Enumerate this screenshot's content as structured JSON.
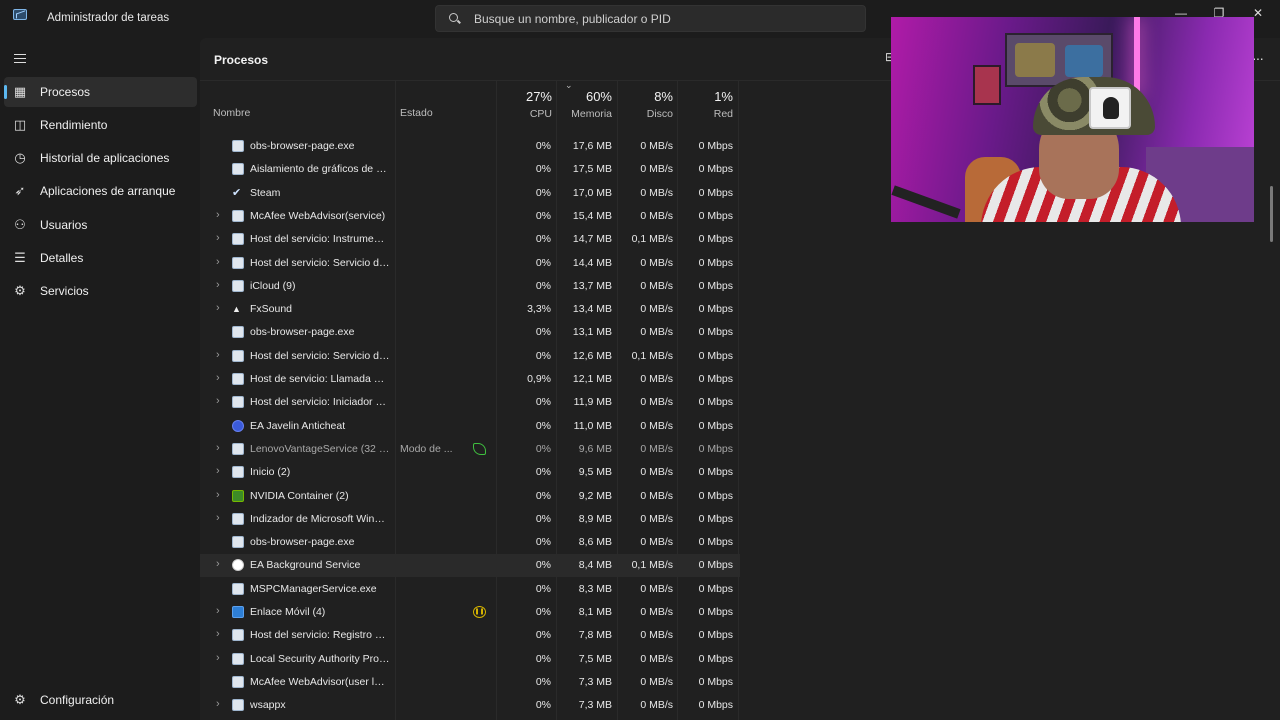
{
  "app": {
    "title": "Administrador de tareas",
    "search_placeholder": "Busque un nombre, publicador o PID",
    "window_buttons": {
      "minimize": "—",
      "restore": "❐",
      "close": "✕"
    }
  },
  "sidebar": {
    "items": [
      {
        "label": "Procesos",
        "icon": "processes-icon",
        "active": true
      },
      {
        "label": "Rendimiento",
        "icon": "performance-icon"
      },
      {
        "label": "Historial de aplicaciones",
        "icon": "history-icon"
      },
      {
        "label": "Aplicaciones de arranque",
        "icon": "startup-icon"
      },
      {
        "label": "Usuarios",
        "icon": "users-icon"
      },
      {
        "label": "Detalles",
        "icon": "details-icon"
      },
      {
        "label": "Servicios",
        "icon": "services-icon"
      }
    ],
    "settings_label": "Configuración"
  },
  "main": {
    "title": "Procesos",
    "columns": {
      "name": "Nombre",
      "status": "Estado",
      "cpu": {
        "pct": "27%",
        "label": "CPU"
      },
      "memory": {
        "pct": "60%",
        "label": "Memoria"
      },
      "disk": {
        "pct": "8%",
        "label": "Disco"
      },
      "network": {
        "pct": "1%",
        "label": "Red"
      }
    },
    "rows": [
      {
        "name": "obs-browser-page.exe",
        "expand": false,
        "icon": "window",
        "status": "",
        "cpu": "0%",
        "mem": "17,6 MB",
        "disk": "0 MB/s",
        "net": "0 Mbps"
      },
      {
        "name": "Aislamiento de gráficos de dis...",
        "expand": false,
        "icon": "window",
        "status": "",
        "cpu": "0%",
        "mem": "17,5 MB",
        "disk": "0 MB/s",
        "net": "0 Mbps"
      },
      {
        "name": "Steam",
        "expand": false,
        "icon": "steam",
        "status": "",
        "cpu": "0%",
        "mem": "17,0 MB",
        "disk": "0 MB/s",
        "net": "0 Mbps"
      },
      {
        "name": "McAfee WebAdvisor(service)",
        "expand": true,
        "icon": "window",
        "status": "",
        "cpu": "0%",
        "mem": "15,4 MB",
        "disk": "0 MB/s",
        "net": "0 Mbps"
      },
      {
        "name": "Host del servicio: Instrumental...",
        "expand": true,
        "icon": "gear",
        "status": "",
        "cpu": "0%",
        "mem": "14,7 MB",
        "disk": "0,1 MB/s",
        "net": "0 Mbps"
      },
      {
        "name": "Host del servicio: Servicio de r...",
        "expand": true,
        "icon": "gear",
        "status": "",
        "cpu": "0%",
        "mem": "14,4 MB",
        "disk": "0 MB/s",
        "net": "0 Mbps"
      },
      {
        "name": "iCloud (9)",
        "expand": true,
        "icon": "window",
        "status": "",
        "cpu": "0%",
        "mem": "13,7 MB",
        "disk": "0 MB/s",
        "net": "0 Mbps"
      },
      {
        "name": "FxSound",
        "expand": true,
        "icon": "fx",
        "status": "",
        "cpu": "3,3%",
        "mem": "13,4 MB",
        "disk": "0 MB/s",
        "net": "0 Mbps"
      },
      {
        "name": "obs-browser-page.exe",
        "expand": false,
        "icon": "window",
        "status": "",
        "cpu": "0%",
        "mem": "13,1 MB",
        "disk": "0 MB/s",
        "net": "0 Mbps"
      },
      {
        "name": "Host del servicio: Servicio de ...",
        "expand": true,
        "icon": "gear",
        "status": "",
        "cpu": "0%",
        "mem": "12,6 MB",
        "disk": "0,1 MB/s",
        "net": "0 Mbps"
      },
      {
        "name": "Host de servicio: Llamada a pr...",
        "expand": true,
        "icon": "gear",
        "status": "",
        "cpu": "0,9%",
        "mem": "12,1 MB",
        "disk": "0 MB/s",
        "net": "0 Mbps"
      },
      {
        "name": "Host del servicio: Iniciador de ...",
        "expand": true,
        "icon": "gear",
        "status": "",
        "cpu": "0%",
        "mem": "11,9 MB",
        "disk": "0 MB/s",
        "net": "0 Mbps"
      },
      {
        "name": "EA Javelin Anticheat",
        "expand": false,
        "icon": "ea",
        "status": "",
        "cpu": "0%",
        "mem": "11,0 MB",
        "disk": "0 MB/s",
        "net": "0 Mbps"
      },
      {
        "name": "LenovoVantageService (32 bits)",
        "expand": true,
        "icon": "window",
        "status": "Modo de ...",
        "badge": "leaf",
        "dim": true,
        "cpu": "0%",
        "mem": "9,6 MB",
        "disk": "0 MB/s",
        "net": "0 Mbps"
      },
      {
        "name": "Inicio (2)",
        "expand": true,
        "icon": "window",
        "status": "",
        "cpu": "0%",
        "mem": "9,5 MB",
        "disk": "0 MB/s",
        "net": "0 Mbps"
      },
      {
        "name": "NVIDIA Container (2)",
        "expand": true,
        "icon": "nvidia",
        "status": "",
        "cpu": "0%",
        "mem": "9,2 MB",
        "disk": "0 MB/s",
        "net": "0 Mbps"
      },
      {
        "name": "Indizador de Microsoft Windo...",
        "expand": true,
        "icon": "window",
        "status": "",
        "cpu": "0%",
        "mem": "8,9 MB",
        "disk": "0 MB/s",
        "net": "0 Mbps"
      },
      {
        "name": "obs-browser-page.exe",
        "expand": false,
        "icon": "window",
        "status": "",
        "cpu": "0%",
        "mem": "8,6 MB",
        "disk": "0 MB/s",
        "net": "0 Mbps"
      },
      {
        "name": "EA Background Service",
        "expand": true,
        "icon": "round",
        "status": "",
        "hover": true,
        "cpu": "0%",
        "mem": "8,4 MB",
        "disk": "0,1 MB/s",
        "net": "0 Mbps"
      },
      {
        "name": "MSPCManagerService.exe",
        "expand": false,
        "icon": "window",
        "status": "",
        "cpu": "0%",
        "mem": "8,3 MB",
        "disk": "0 MB/s",
        "net": "0 Mbps"
      },
      {
        "name": "Enlace Móvil (4)",
        "expand": true,
        "icon": "blue",
        "status": "",
        "badge": "pause",
        "cpu": "0%",
        "mem": "8,1 MB",
        "disk": "0 MB/s",
        "net": "0 Mbps"
      },
      {
        "name": "Host del servicio: Registro de ...",
        "expand": true,
        "icon": "gear",
        "status": "",
        "cpu": "0%",
        "mem": "7,8 MB",
        "disk": "0 MB/s",
        "net": "0 Mbps"
      },
      {
        "name": "Local Security Authority Proce...",
        "expand": true,
        "icon": "window",
        "status": "",
        "cpu": "0%",
        "mem": "7,5 MB",
        "disk": "0 MB/s",
        "net": "0 Mbps"
      },
      {
        "name": "McAfee WebAdvisor(user level...",
        "expand": false,
        "icon": "window",
        "status": "",
        "cpu": "0%",
        "mem": "7,3 MB",
        "disk": "0 MB/s",
        "net": "0 Mbps"
      },
      {
        "name": "wsappx",
        "expand": true,
        "icon": "gear",
        "status": "",
        "cpu": "0%",
        "mem": "7,3 MB",
        "disk": "0 MB/s",
        "net": "0 Mbps"
      }
    ]
  }
}
